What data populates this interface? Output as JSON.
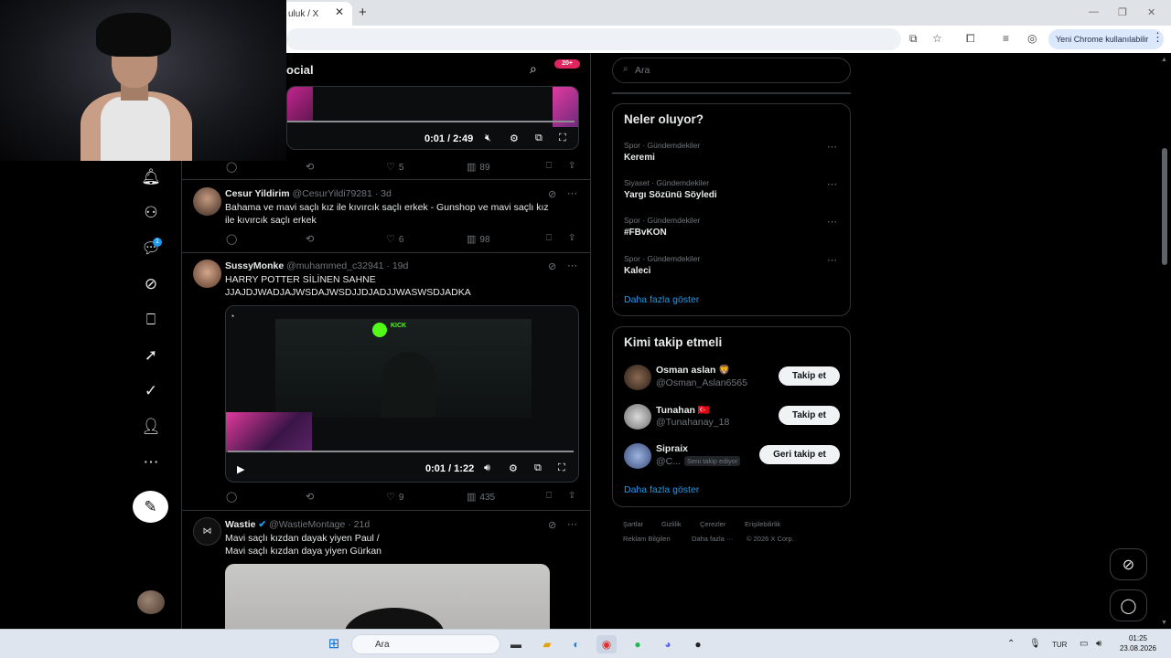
{
  "browser": {
    "tab_title": "uluk / X",
    "tab_close": "✕",
    "new_tab": "+",
    "window_controls": [
      "—",
      "❐",
      "✕"
    ],
    "update_chip": "Yeni Chrome kullanılabilir",
    "menu": "⋮"
  },
  "timeline": {
    "header_title": "ocial",
    "notif_badge": "20+",
    "video1": {
      "time": "0:01 / 2:49"
    },
    "tweet1_actions": {
      "likes": "5",
      "views": "89"
    },
    "tweets": [
      {
        "name": "Cesur Yildirim",
        "handle": "@CesurYildi79281 · 3d",
        "text1": "Bahama ve mavi saçlı kız ile kıvırcık saçlı erkek - Gunshop ve mavi saçlı kız",
        "text2": "ile kıvırcık saçlı erkek",
        "likes": "6",
        "views": "98"
      },
      {
        "name": "SussyMonke",
        "handle": "@muhammed_c32941 · 19d",
        "text1": "HARRY POTTER SİLİNEN SAHNE",
        "text2": "JJAJDJWADJAJWSDAJWSDJJDJADJJWASWSDJADKA",
        "video_time": "0:01 / 1:22",
        "video_brand": "KICK",
        "likes": "9",
        "views": "435"
      },
      {
        "name": "Wastie",
        "handle": "@WastieMontage · 21d",
        "text1": "Mavi saçlı kızdan dayak yiyen Paul /",
        "text2": "Mavi saçlı kızdan daya yiyen Gürkan"
      }
    ]
  },
  "right": {
    "search_placeholder": "Ara",
    "trends_title": "Neler oluyor?",
    "trends": [
      {
        "category": "Spor · Gündemdekiler",
        "name": "Keremi"
      },
      {
        "category": "Siyaset · Gündemdekiler",
        "name": "Yargı Sözünü Söyledi"
      },
      {
        "category": "Spor · Gündemdekiler",
        "name": "#FBvKON"
      },
      {
        "category": "Spor · Gündemdekiler",
        "name": "Kaleci"
      }
    ],
    "show_more": "Daha fazla göster",
    "wtf_title": "Kimi takip etmeli",
    "wtf": [
      {
        "name": "Osman aslan 🦁",
        "handle": "@Osman_Aslan6565",
        "button": "Takip et"
      },
      {
        "name": "Tunahan 🇹🇷",
        "handle": "@Tunahanay_18",
        "button": "Takip et"
      },
      {
        "name": "Sipraix",
        "handle": "@C...",
        "follows_you": "Seni takip ediyor",
        "button": "Geri takip et"
      }
    ],
    "footer": [
      "Şartlar",
      "Gizlilik",
      "Çerezler",
      "Erişilebilirlik",
      "Reklam Bilgileri",
      "Daha fazla ···",
      "© 2026 X Corp."
    ]
  },
  "taskbar": {
    "search": "Ara",
    "lang": "TUR",
    "time": "01:25",
    "date": "23.08.2026"
  },
  "colors": {
    "accent": "#1d9bf0",
    "badge": "#e0245e",
    "background": "#000000"
  }
}
